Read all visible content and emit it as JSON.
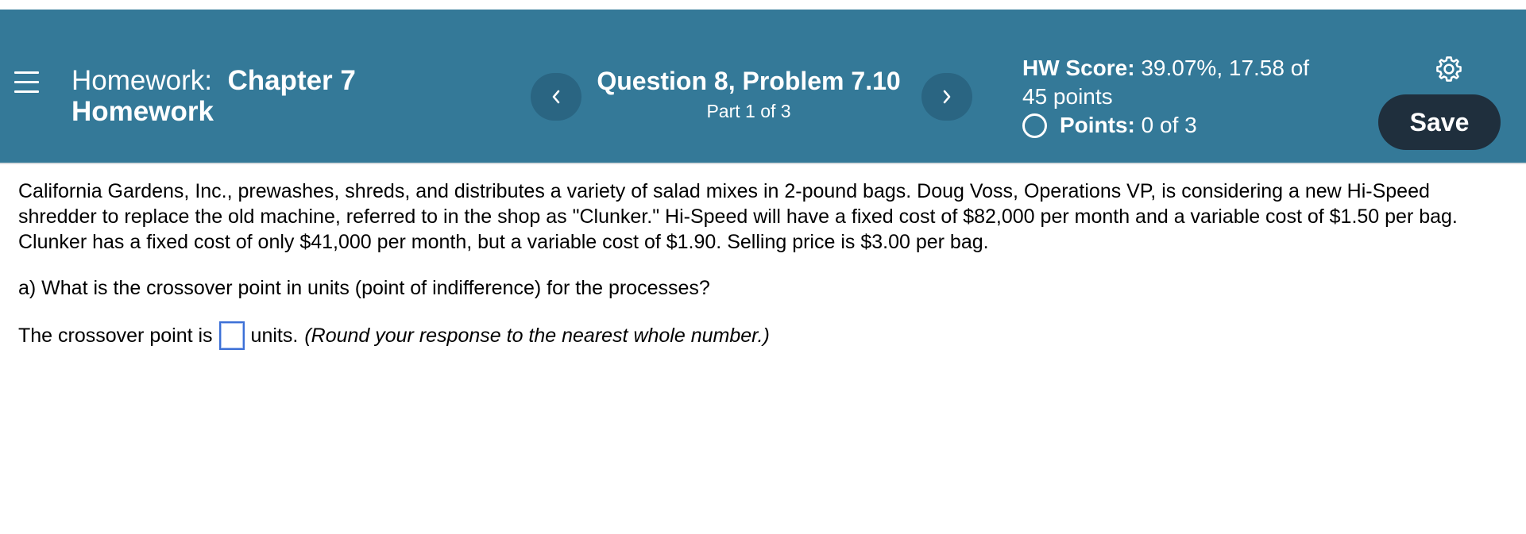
{
  "header": {
    "homework_label": "Homework:",
    "homework_name_line1": "Chapter 7",
    "homework_name_line2": "Homework",
    "question_title": "Question 8, Problem 7.10",
    "question_part": "Part 1 of 3",
    "prev_glyph": "‹",
    "next_glyph": "›",
    "score_label": "HW Score:",
    "score_value": "39.07%, 17.58 of",
    "score_value_line2": "45 points",
    "points_label": "Points:",
    "points_value": "0 of 3",
    "save_label": "Save",
    "icons": {
      "menu": "hamburger-menu-icon",
      "prev": "chevron-left-icon",
      "next": "chevron-right-icon",
      "settings": "gear-icon",
      "points_status": "open-circle-icon"
    }
  },
  "problem": {
    "statement": "California Gardens, Inc., prewashes, shreds, and distributes a variety of salad mixes in 2-pound bags. Doug Voss, Operations VP, is considering a new Hi-Speed shredder to replace the old machine, referred to in the shop as \"Clunker.\" Hi-Speed will have a fixed cost of $82,000 per month and a variable cost of $1.50 per bag. Clunker has a fixed cost of only $41,000 per month, but a variable cost of $1.90. Selling price is $3.00 per bag.",
    "question_a": "a) What is the crossover point in units (point of indifference) for the processes?",
    "answer_prefix": "The crossover point is",
    "answer_value": "",
    "answer_suffix": "units.",
    "answer_instruction": "(Round your response to the nearest whole number.)"
  },
  "colors": {
    "header_bg": "#347998",
    "nav_button_bg": "#2a6582",
    "save_button_bg": "#1f2f3d",
    "input_border": "#3b6fd6"
  }
}
